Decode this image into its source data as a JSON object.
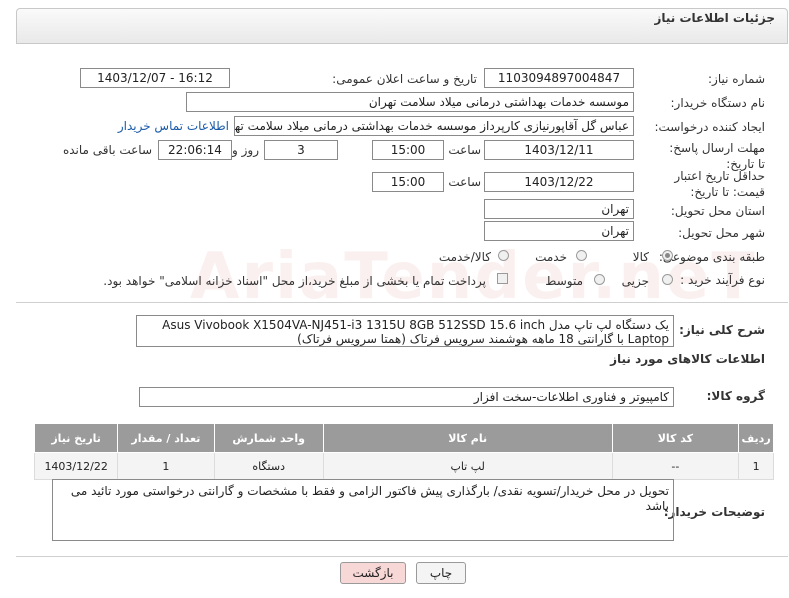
{
  "panel_title": "جزئیات اطلاعات نیاز",
  "fields": {
    "need_number_label": "شماره نیاز:",
    "need_number": "1103094897004847",
    "announce_label": "تاریخ و ساعت اعلان عمومی:",
    "announce_value": "1403/12/07 - 16:12",
    "buyer_org_label": "نام دستگاه خریدار:",
    "buyer_org": "موسسه خدمات بهداشتی درمانی میلاد سلامت تهران",
    "creator_label": "ایجاد کننده درخواست:",
    "creator": "عباس گل آقاپورنیازی کارپرداز موسسه خدمات بهداشتی درمانی میلاد سلامت تهران",
    "contact_link": "اطلاعات تماس خریدار",
    "deadline_label": "مهلت ارسال پاسخ: تا تاریخ:",
    "deadline_date": "1403/12/11",
    "time_label": "ساعت",
    "deadline_time": "15:00",
    "days_value": "3",
    "days_label": "روز و",
    "remaining_time": "22:06:14",
    "remaining_label": "ساعت باقی مانده",
    "validity_label": "حداقل تاریخ اعتبار قیمت: تا تاریخ:",
    "validity_date": "1403/12/22",
    "validity_time": "15:00",
    "province_label": "استان محل تحویل:",
    "province": "تهران",
    "city_label": "شهر محل تحویل:",
    "city": "تهران",
    "category_label": "طبقه بندی موضوعی:",
    "category_options": [
      "کالا",
      "خدمت",
      "کالا/خدمت"
    ],
    "category_selected": "کالا",
    "process_label": "نوع فرآیند خرید :",
    "process_options": [
      "جزیی",
      "متوسط"
    ],
    "payment_note": "پرداخت تمام یا بخشی از مبلغ خرید،از محل \"اسناد خزانه اسلامی\" خواهد بود."
  },
  "description": {
    "label": "شرح کلی نیاز:",
    "text": "یک دستگاه لپ تاپ مدل Asus Vivobook X1504VA-NJ451-i3 1315U 8GB 512SSD 15.6 inch Laptop  با گارانتی 18 ماهه هوشمند سرویس فرتاک (همتا سرویس فرتاک)"
  },
  "goods_section_title": "اطلاعات کالاهای مورد نیاز",
  "goods_group_label": "گروه کالا:",
  "goods_group": "کامپیوتر و فناوری اطلاعات-سخت افزار",
  "table": {
    "headers": [
      "ردیف",
      "کد کالا",
      "نام کالا",
      "واحد شمارش",
      "تعداد / مقدار",
      "تاریخ نیاز"
    ],
    "rows": [
      [
        "1",
        "--",
        "لپ تاپ",
        "دستگاه",
        "1",
        "1403/12/22"
      ]
    ]
  },
  "buyer_notes_label": "توضیحات خریدار:",
  "buyer_notes": "تحویل در محل خریدار/تسویه نقدی/ بارگذاری پیش فاکتور الزامی و فقط با مشخصات و گارانتی درخواستی مورد تائید می باشد",
  "buttons": {
    "print": "چاپ",
    "back": "بازگشت"
  },
  "colors": {
    "back_button_bg": "#f8d7d7",
    "table_header_bg": "#9b9b9b",
    "link": "#1a5aa8"
  }
}
